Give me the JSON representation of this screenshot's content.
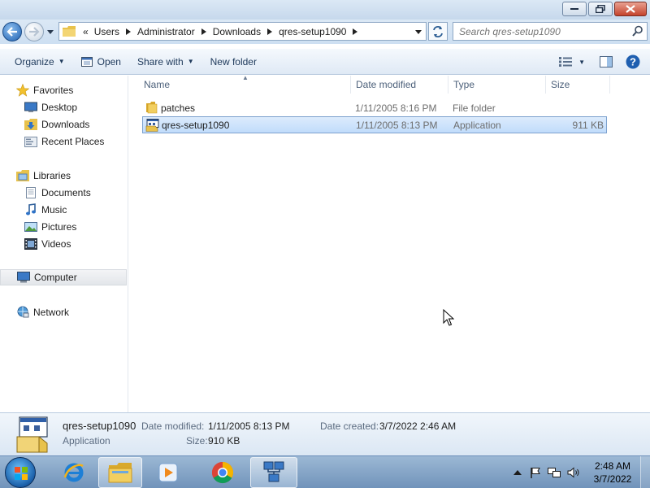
{
  "window": {
    "minimize_label": "",
    "maximize_label": "",
    "close_label": ""
  },
  "address": {
    "overflow": "«",
    "crumbs": [
      "Users",
      "Administrator",
      "Downloads",
      "qres-setup1090"
    ]
  },
  "search": {
    "placeholder": "Search qres-setup1090"
  },
  "toolbar": {
    "organize": "Organize",
    "open": "Open",
    "share_with": "Share with",
    "new_folder": "New folder"
  },
  "nav": {
    "favorites": "Favorites",
    "desktop": "Desktop",
    "downloads": "Downloads",
    "recent_places": "Recent Places",
    "libraries": "Libraries",
    "documents": "Documents",
    "music": "Music",
    "pictures": "Pictures",
    "videos": "Videos",
    "computer": "Computer",
    "network": "Network"
  },
  "columns": {
    "name": "Name",
    "date_modified": "Date modified",
    "type": "Type",
    "size": "Size"
  },
  "files": [
    {
      "name": "patches",
      "date": "1/11/2005 8:16 PM",
      "type": "File folder",
      "size": ""
    },
    {
      "name": "qres-setup1090",
      "date": "1/11/2005 8:13 PM",
      "type": "Application",
      "size": "911 KB"
    }
  ],
  "details": {
    "name": "qres-setup1090",
    "type": "Application",
    "date_modified_label": "Date modified:",
    "date_modified": "1/11/2005 8:13 PM",
    "size_label": "Size:",
    "size": "910 KB",
    "date_created_label": "Date created:",
    "date_created": "3/7/2022 2:46 AM"
  },
  "taskbar": {
    "time": "2:48 AM",
    "date": "3/7/2022"
  }
}
